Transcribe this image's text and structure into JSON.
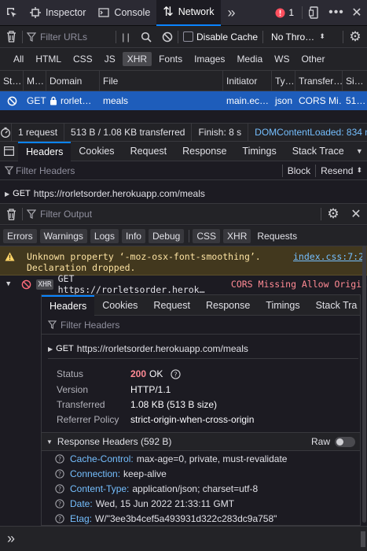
{
  "toolbox": {
    "tabs": [
      {
        "label": "Inspector",
        "icon": "inspector-icon"
      },
      {
        "label": "Console",
        "icon": "console-icon"
      },
      {
        "label": "Network",
        "icon": "network-icon"
      }
    ],
    "error_count": "1",
    "colors": {
      "accent": "#0a84ff",
      "error": "#ff4f5e"
    }
  },
  "net_toolbar": {
    "filter_placeholder": "Filter URLs",
    "pause_glyph": "| |",
    "disable_cache_label": "Disable Cache",
    "throttle_value": "No Thro…"
  },
  "type_filters": [
    "All",
    "HTML",
    "CSS",
    "JS",
    "XHR",
    "Fonts",
    "Images",
    "Media",
    "WS",
    "Other"
  ],
  "table": {
    "headers": [
      "St…",
      "M…",
      "Domain",
      "File",
      "Initiator",
      "Ty…",
      "Transfer…",
      "Si…"
    ],
    "row": {
      "method": "GET",
      "domain": "rorlet…",
      "file": "meals",
      "initiator": "main.ec…",
      "type": "json",
      "transferred": "CORS Mi…",
      "size": "51…"
    }
  },
  "statusbar": {
    "requests": "1 request",
    "transferred": "513 B / 1.08 KB transferred",
    "finish": "Finish: 8 s",
    "dcl": "DOMContentLoaded: 834 m"
  },
  "detail_tabs": [
    "Headers",
    "Cookies",
    "Request",
    "Response",
    "Timings",
    "Stack Trace"
  ],
  "filter_headers_placeholder": "Filter Headers",
  "block_label": "Block",
  "resend_label": "Resend",
  "get_line": {
    "method": "GET",
    "url": "https://rorletsorder.herokuapp.com/meals"
  },
  "console": {
    "filter_placeholder": "Filter Output",
    "filters": [
      "Errors",
      "Warnings",
      "Logs",
      "Info",
      "Debug"
    ],
    "filters2": [
      "CSS",
      "XHR"
    ],
    "requests_label": "Requests",
    "warning": {
      "line1": "Unknown property ‘-moz-osx-font-smoothing’.",
      "line2": "Declaration dropped.",
      "source": "index.css:7:2"
    },
    "cors": {
      "badge": "XHR",
      "text": "GET https://rorletsorder.herok…",
      "error": "CORS Missing Allow Origin"
    }
  },
  "inner": {
    "tabs": [
      "Headers",
      "Cookies",
      "Request",
      "Response",
      "Timings",
      "Stack Tra"
    ],
    "filter_placeholder": "Filter Headers",
    "get_method": "GET",
    "get_url": "https://rorletsorder.herokuapp.com/meals",
    "status_key": "Status",
    "status_code": "200",
    "status_text": "OK",
    "version_key": "Version",
    "version_val": "HTTP/1.1",
    "transferred_key": "Transferred",
    "transferred_val": "1.08 KB (513 B size)",
    "referrer_key": "Referrer Policy",
    "referrer_val": "strict-origin-when-cross-origin",
    "resp_headers_label": "Response Headers (592 B)",
    "raw_label": "Raw",
    "headers": [
      {
        "name": "Cache-Control:",
        "value": "max-age=0, private, must-revalidate"
      },
      {
        "name": "Connection:",
        "value": "keep-alive"
      },
      {
        "name": "Content-Type:",
        "value": "application/json; charset=utf-8"
      },
      {
        "name": "Date:",
        "value": "Wed, 15 Jun 2022 21:33:11 GMT"
      },
      {
        "name": "Etag:",
        "value": "W/\"3ee3b4cef5a493931d322c283dc9a758\""
      }
    ]
  },
  "prompt_glyph": "»"
}
